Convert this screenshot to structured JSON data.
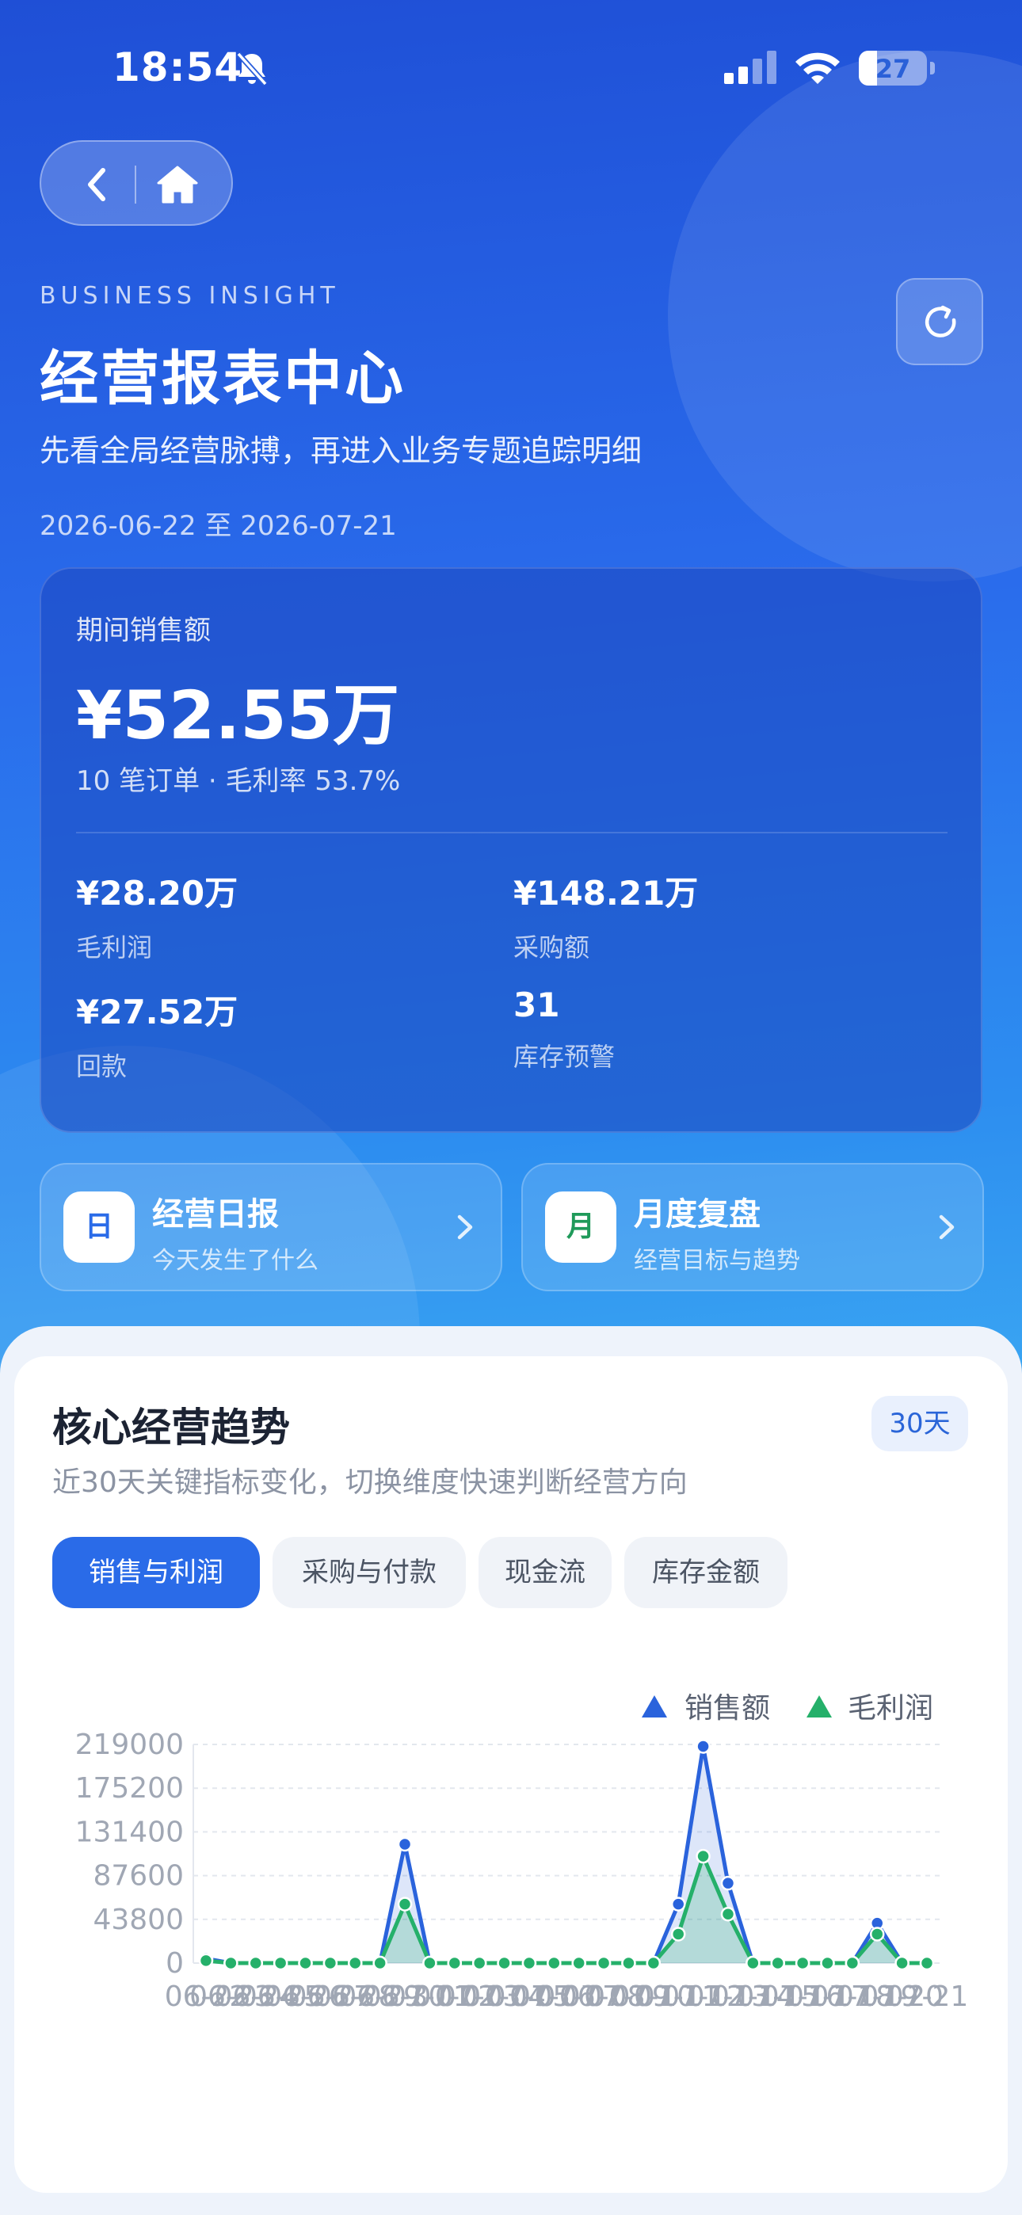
{
  "status_bar": {
    "time": "18:54",
    "battery": "27",
    "battery_level": 0.27
  },
  "header": {
    "eyebrow": "BUSINESS INSIGHT",
    "title": "经营报表中心",
    "subtitle": "先看全局经营脉搏，再进入业务专题追踪明细",
    "date_range": "2026-06-22 至 2026-07-21"
  },
  "summary": {
    "label": "期间销售额",
    "value": "¥52.55万",
    "meta": "10 笔订单 · 毛利率 53.7%",
    "metrics": [
      {
        "value": "¥28.20万",
        "label": "毛利润"
      },
      {
        "value": "¥148.21万",
        "label": "采购额"
      },
      {
        "value": "¥27.52万",
        "label": "回款"
      },
      {
        "value": "31",
        "label": "库存预警"
      }
    ]
  },
  "quick_links": [
    {
      "badge": "日",
      "title": "经营日报",
      "subtitle": "今天发生了什么",
      "badge_color": "#2a6be8"
    },
    {
      "badge": "月",
      "title": "月度复盘",
      "subtitle": "经营目标与趋势",
      "badge_color": "#1f9a5a"
    }
  ],
  "trend": {
    "title": "核心经营趋势",
    "subtitle": "近30天关键指标变化，切换维度快速判断经营方向",
    "period": "30天",
    "tabs": [
      {
        "label": "销售与利润",
        "active": true
      },
      {
        "label": "采购与付款",
        "active": false
      },
      {
        "label": "现金流",
        "active": false
      },
      {
        "label": "库存金额",
        "active": false
      }
    ]
  },
  "colors": {
    "sales": "#2a63dc",
    "profit": "#25b06a",
    "accent": "#2a6be8"
  },
  "chart_data": {
    "type": "area",
    "x": [
      "06-22",
      "06-23",
      "06-24",
      "06-25",
      "06-26",
      "06-27",
      "06-28",
      "06-29",
      "06-30",
      "07-01",
      "07-02",
      "07-03",
      "07-04",
      "07-05",
      "07-06",
      "07-07",
      "07-08",
      "07-09",
      "07-10",
      "07-11",
      "07-12",
      "07-13",
      "07-14",
      "07-15",
      "07-16",
      "07-17",
      "07-18",
      "07-19",
      "07-20",
      "07-21"
    ],
    "series": [
      {
        "name": "销售额",
        "values": [
          4500,
          0,
          0,
          0,
          0,
          0,
          0,
          0,
          119000,
          0,
          0,
          0,
          0,
          0,
          0,
          0,
          0,
          0,
          0,
          59000,
          217000,
          80000,
          0,
          0,
          0,
          0,
          0,
          40000,
          0,
          0
        ]
      },
      {
        "name": "毛利润",
        "values": [
          2500,
          0,
          0,
          0,
          0,
          0,
          0,
          0,
          59000,
          0,
          0,
          0,
          0,
          0,
          0,
          0,
          0,
          0,
          0,
          29000,
          107000,
          49000,
          0,
          0,
          0,
          0,
          0,
          29000,
          0,
          0
        ]
      }
    ],
    "yticks": [
      0,
      43800,
      87600,
      131400,
      175200,
      219000
    ],
    "ylim": [
      0,
      219000
    ],
    "legend": "top-right",
    "grid": true
  }
}
